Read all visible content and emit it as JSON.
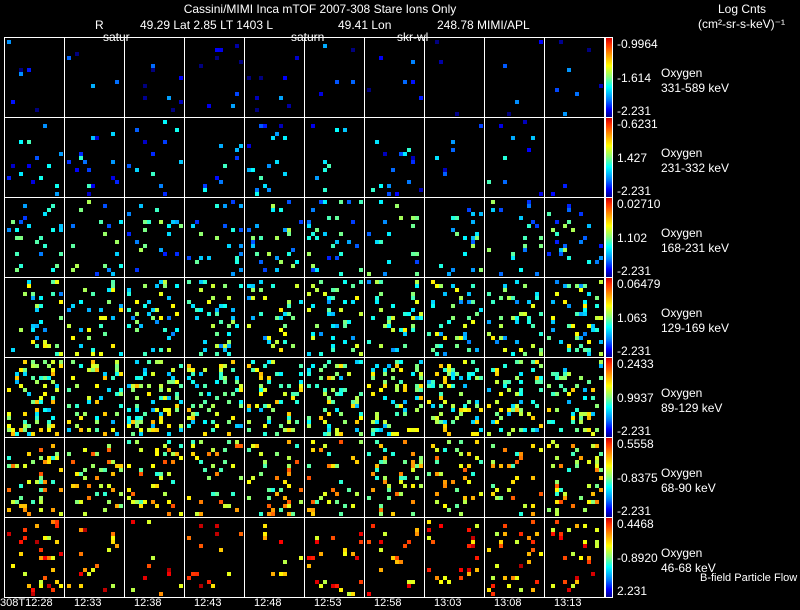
{
  "header": {
    "title": "Cassini/MIMI Inca mTOF  2007-308   Stare   Ions Only",
    "r_label": "R",
    "position_info": "49.29 Lat 2.85 LT 1403 L",
    "lon_info": "49.41 Lon",
    "lon_value": "248.78  MIMI/APL",
    "overlay_1": "satur",
    "overlay_2": "saturn",
    "overlay_3": "skr-wl"
  },
  "units": {
    "line1": "Log Cnts",
    "line2": "(cm²-sr-s-keV)⁻¹"
  },
  "chart_data": {
    "type": "heatmap",
    "title": "Cassini/MIMI Inca mTOF  2007-308   Stare   Ions Only",
    "colormap": "jet",
    "x_tick_labels": [
      "308T12:28",
      "12:33",
      "12:38",
      "12:43",
      "12:48",
      "12:53",
      "12:58",
      "13:03",
      "13:08",
      "13:13"
    ],
    "rows": [
      {
        "species": "Oxygen",
        "energy": "331-589 keV",
        "cmax": "-0.9964",
        "cmid": "-1.614",
        "cmin": "-2.231",
        "density": 0.02,
        "level": 0.1
      },
      {
        "species": "Oxygen",
        "energy": "231-332 keV",
        "cmax": "-0.6231",
        "cmid": "1.427",
        "cmin": "-2.231",
        "density": 0.04,
        "level": 0.25
      },
      {
        "species": "Oxygen",
        "energy": "168-231 keV",
        "cmax": "0.02710",
        "cmid": "1.102",
        "cmin": "-2.231",
        "density": 0.08,
        "level": 0.35
      },
      {
        "species": "Oxygen",
        "energy": "129-169 keV",
        "cmax": "0.06479",
        "cmid": "1.063",
        "cmin": "-2.231",
        "density": 0.14,
        "level": 0.45
      },
      {
        "species": "Oxygen",
        "energy": "89-129 keV",
        "cmax": "0.2433",
        "cmid": "0.9937",
        "cmin": "-2.231",
        "density": 0.22,
        "level": 0.5
      },
      {
        "species": "Oxygen",
        "energy": "68-90 keV",
        "cmax": "0.5558",
        "cmid": "-0.8375",
        "cmin": "-2.231",
        "density": 0.15,
        "level": 0.6
      },
      {
        "species": "Oxygen",
        "energy": "46-68 keV",
        "cmax": "0.4468",
        "cmid": "-0.8920",
        "cmin": "2.231",
        "density": 0.07,
        "level": 0.75
      }
    ],
    "footer_note": "B-field Particle Flow"
  }
}
